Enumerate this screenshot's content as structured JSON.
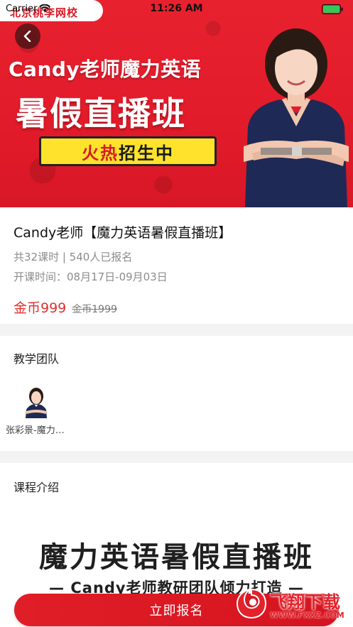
{
  "status_bar": {
    "carrier": "Carrier",
    "time": "11:26 AM"
  },
  "banner": {
    "brand": "北京桃李网校",
    "title": "Candy老师魔力英语",
    "subtitle": "暑假直播班",
    "tag_hot": "火热",
    "tag_rest": "招生中"
  },
  "course": {
    "title": "Candy老师【魔力英语暑假直播班】",
    "meta": "共32课时 | 540人已报名",
    "dates": "开课时间：08月17日-09月03日",
    "price_now": "金币999",
    "price_old": "金币1999"
  },
  "team": {
    "section_title": "教学团队",
    "members": [
      {
        "name": "张彩景-魔力…"
      }
    ]
  },
  "intro": {
    "section_title": "课程介绍",
    "heading": "魔力英语暑假直播班",
    "subheading": "— Candy老师教研团队倾力打造 —"
  },
  "cta": {
    "label": "立即报名"
  },
  "watermark": {
    "text": "飞翔下载",
    "url": "WWW.FXXZ.COM"
  },
  "colors": {
    "brand_red": "#e21b2a",
    "price_red": "#e0312e",
    "tag_yellow": "#ffe22c"
  }
}
